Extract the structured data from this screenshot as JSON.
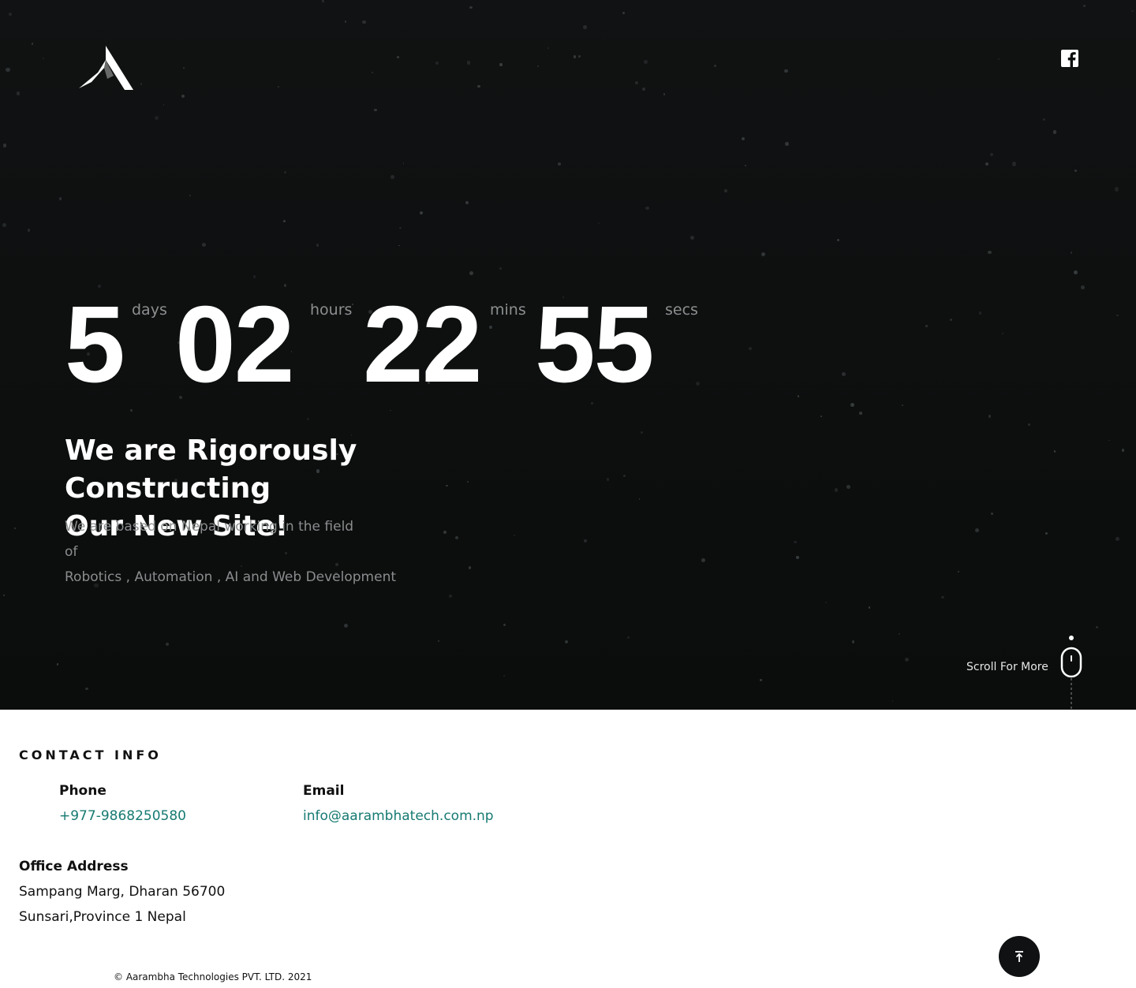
{
  "header": {
    "logo_icon": "aarambha-peak-logo",
    "social_icon": "facebook-icon"
  },
  "countdown": {
    "days": "5",
    "days_label": "days",
    "hours": "02",
    "hours_label": "hours",
    "mins": "22",
    "mins_label": "mins",
    "secs": "55",
    "secs_label": "secs"
  },
  "hero": {
    "headline_line1": "We are Rigorously Constructing",
    "headline_line2": "Our New Site!",
    "sub_line1": "We are based on Nepal working in the field",
    "sub_line2": "of",
    "sub_line3": "Robotics , Automation , AI and Web Development",
    "scroll_label": "Scroll For More"
  },
  "contact": {
    "title": "CONTACT INFO",
    "phone_label": "Phone",
    "phone_value": "+977-9868250580",
    "email_label": "Email",
    "email_value": "info@aarambhatech.com.np",
    "address_label": "Office Address",
    "address_line1": "Sampang Marg, Dharan 56700",
    "address_line2": "Sunsari,Province 1 Nepal"
  },
  "footer": {
    "copyright": "© Aarambha Technologies PVT. LTD. 2021",
    "top_icon": "arrow-up-to-top-icon"
  },
  "colors": {
    "hero_bg": "#0d0f0f",
    "accent_link": "#167a72",
    "muted_text": "#8a8d8e"
  }
}
